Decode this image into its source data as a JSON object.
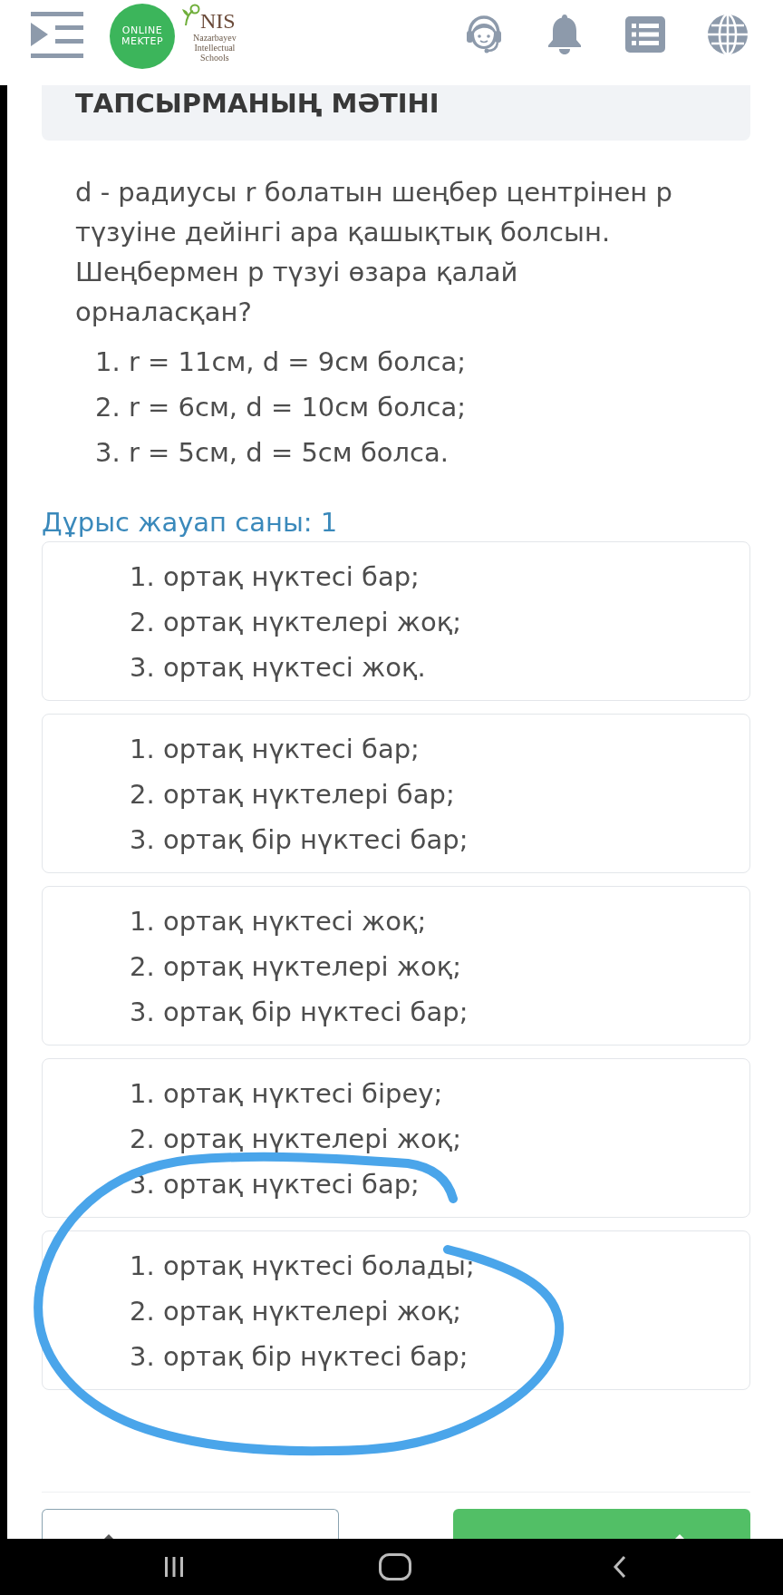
{
  "header": {
    "logo_text": [
      "ONLINE",
      "MEKTEP"
    ],
    "school_title": "NIS",
    "school_subtitle": [
      "Nazarbayev",
      "Intellectual",
      "Schools"
    ]
  },
  "task_heading": "ТАПСЫРМАНЫҢ МӘТІНІ",
  "question": {
    "text": "d - радиусы r болатын шеңбер центрінен р түзуіне дейінгі ара қашықтық болсын. Шеңбермен р түзуі өзара қалай орналасқан?",
    "cases": [
      "1. r = 11см, d = 9см болса;",
      "2. r = 6см, d = 10см болса;",
      "3. r = 5см, d = 5см болса."
    ]
  },
  "correct_answer_count": "Дұрыс жауап саны: 1",
  "answer_options": [
    {
      "lines": [
        "1. ортақ нүктесі бар;",
        "2. ортақ нүктелері жоқ;",
        "3. ортақ нүктесі жоқ."
      ]
    },
    {
      "lines": [
        "1. ортақ нүктесі бар;",
        "2. ортақ нүктелері бар;",
        "3. ортақ бір нүктесі бар;"
      ]
    },
    {
      "lines": [
        "1. ортақ нүктесі жоқ;",
        "2. ортақ нүктелері жоқ;",
        "3. ортақ бір нүктесі бар;"
      ]
    },
    {
      "lines": [
        "1. ортақ нүктесі біреу;",
        "2. ортақ нүктелері жоқ;",
        "3. ортақ нүктесі бар;"
      ]
    },
    {
      "lines": [
        "1. ортақ нүктесі болады;",
        "2. ортақ нүктелері жоқ;",
        "3. ортақ бір нүктесі бар;"
      ]
    }
  ]
}
